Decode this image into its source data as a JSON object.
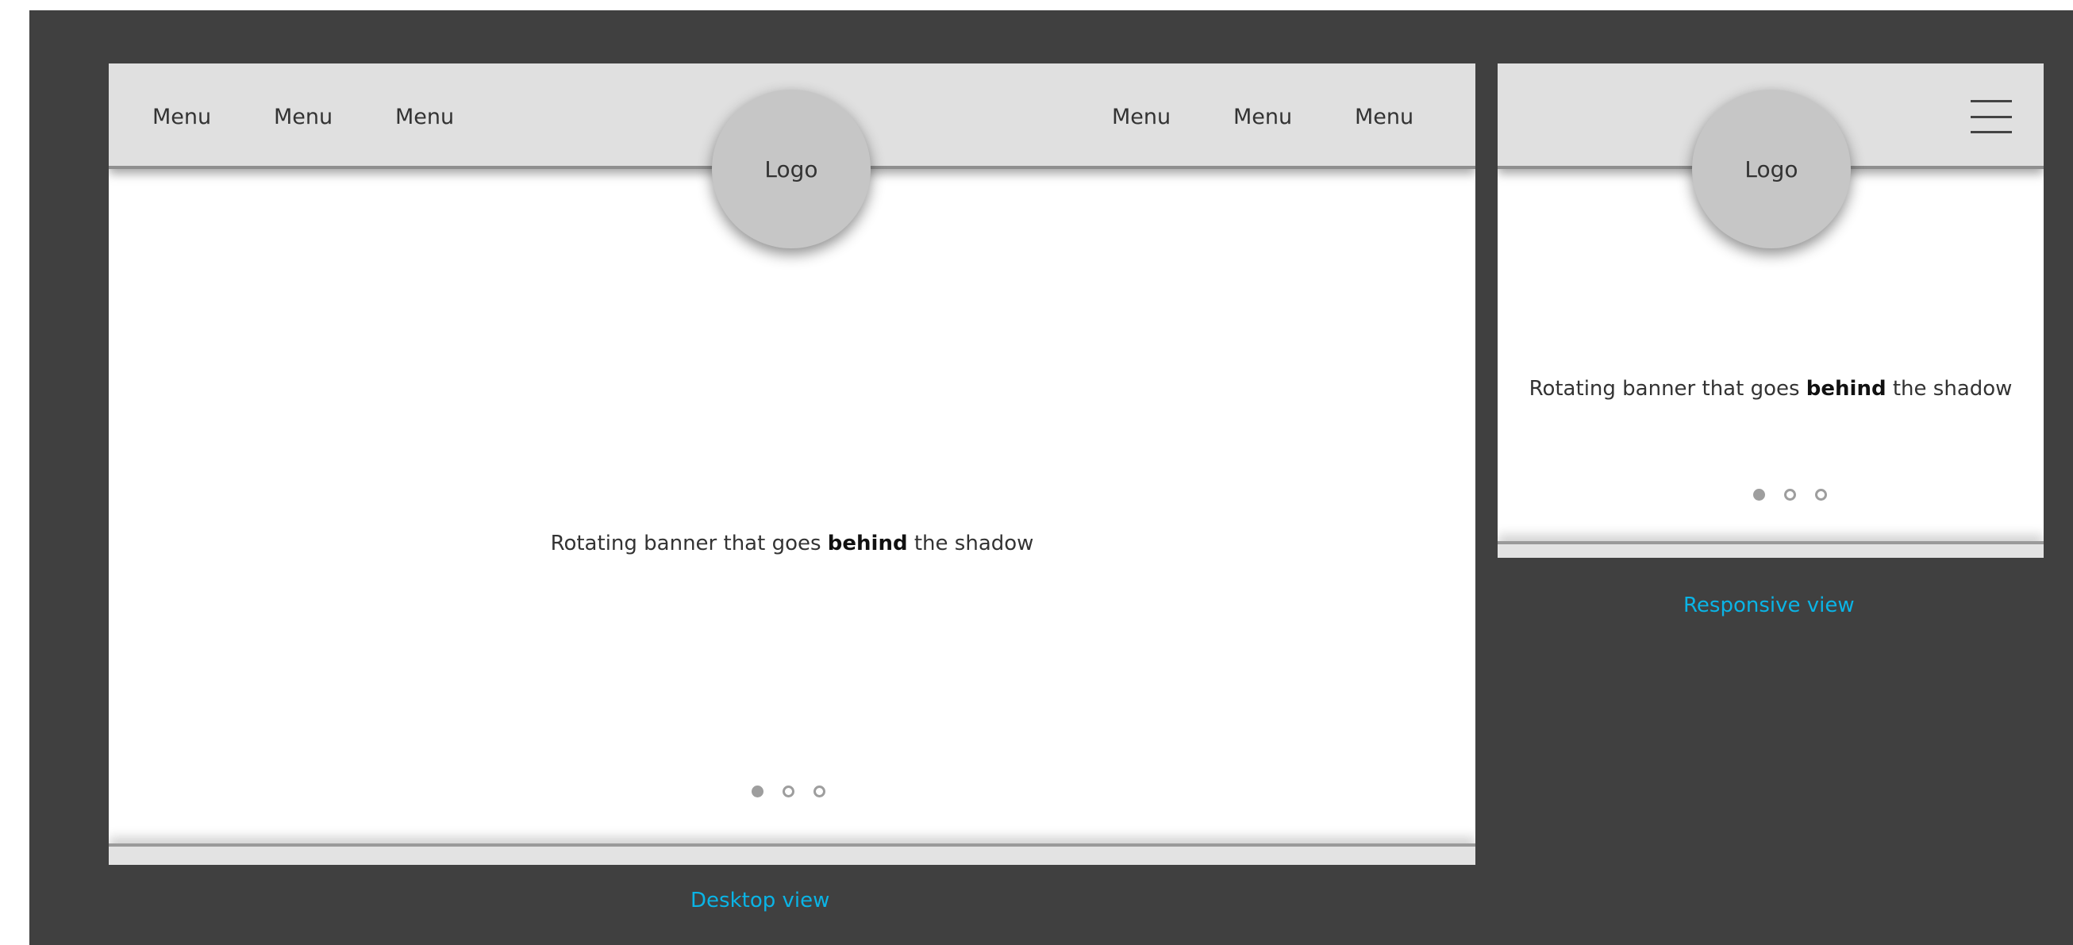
{
  "desktop": {
    "menu_left": [
      "Menu",
      "Menu",
      "Menu"
    ],
    "menu_right": [
      "Menu",
      "Menu",
      "Menu"
    ],
    "logo": "Logo",
    "banner": {
      "before": "Rotating banner that goes ",
      "bold": "behind",
      "after": " the shadow"
    },
    "caption": "Desktop view"
  },
  "mobile": {
    "logo": "Logo",
    "menu_icon": "hamburger-menu-icon",
    "banner": {
      "before": "Rotating banner that goes ",
      "bold": "behind",
      "after": " the shadow"
    },
    "caption": "Responsive view"
  },
  "carousel": {
    "dot_count": 3,
    "active_index": 0
  },
  "colors": {
    "background": "#404040",
    "header": "#e0e0e0",
    "logo_circle": "#c6c6c6",
    "caption": "#0ab4e6"
  }
}
